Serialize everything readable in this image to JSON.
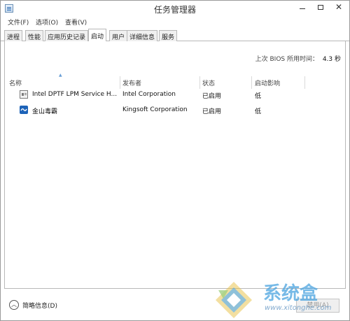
{
  "window": {
    "title": "任务管理器"
  },
  "menu": [
    "文件(F)",
    "选项(O)",
    "查看(V)"
  ],
  "tabs": [
    "进程",
    "性能",
    "应用历史记录",
    "启动",
    "用户",
    "详细信息",
    "服务"
  ],
  "active_tab": "启动",
  "bios": {
    "label": "上次 BIOS 所用时间：",
    "value": "4.3 秒"
  },
  "columns": [
    "名称",
    "发布者",
    "状态",
    "启动影响"
  ],
  "rows": [
    {
      "icon": "service-icon",
      "name": "Intel DPTF LPM Service H...",
      "publisher": "Intel Corporation",
      "status": "已启用",
      "impact": "低"
    },
    {
      "icon": "kingsoft-antivirus-icon",
      "name": "金山毒霸",
      "publisher": "Kingsoft Corporation",
      "status": "已启用",
      "impact": "低"
    }
  ],
  "footer": {
    "fewer_details": "简略信息(D)",
    "disable_button": "禁用(A)"
  },
  "watermark": {
    "text": "系统盒",
    "url": "www.xitonghe.com"
  },
  "colors": {
    "accent": "#1d63b8",
    "watermark": "#4aa3e0"
  }
}
